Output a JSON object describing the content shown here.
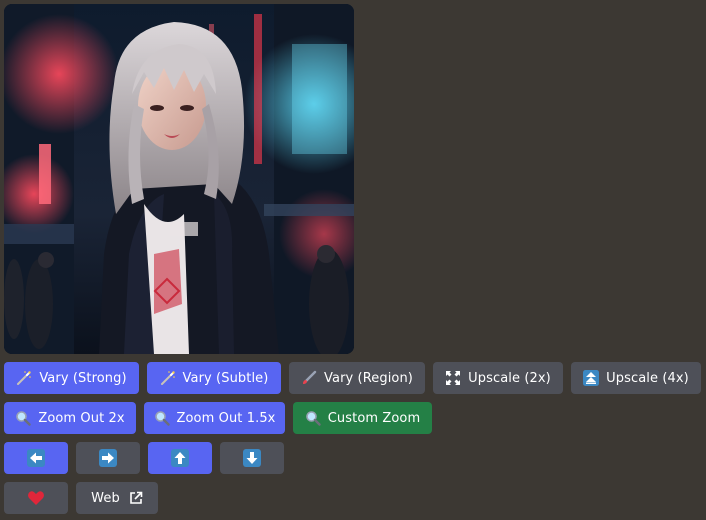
{
  "image": {
    "subject_icon": "cyberpunk-portrait-image",
    "palette": {
      "neon_red": "#ff3b4f",
      "neon_cyan": "#47d6ff",
      "night": "#0c1523",
      "jacket": "#141824",
      "hair": "#c9c4c8"
    }
  },
  "colors": {
    "background": "#3c3833",
    "primary_button": "#5865f2",
    "secondary_button": "#4e5058",
    "success_button": "#248046",
    "heart": "#e0263a"
  },
  "rows": {
    "vary": {
      "strong_label": "Vary (Strong)",
      "strong_icon": "magic-wand-icon",
      "subtle_label": "Vary (Subtle)",
      "subtle_icon": "magic-wand-icon",
      "region_label": "Vary (Region)",
      "region_icon": "paintbrush-icon"
    },
    "upscale": {
      "x2_label": "Upscale (2x)",
      "x2_icon": "expand-icon",
      "x4_label": "Upscale (4x)",
      "x4_icon": "arrow-up-double-icon"
    },
    "zoom": {
      "out2_label": "Zoom Out 2x",
      "out15_label": "Zoom Out 1.5x",
      "custom_label": "Custom Zoom",
      "icon": "magnifier-icon"
    },
    "pan": {
      "left_icon": "arrow-left-icon",
      "right_icon": "arrow-right-icon",
      "up_icon": "arrow-up-icon",
      "down_icon": "arrow-down-icon"
    },
    "actions": {
      "favorite_icon": "heart-icon",
      "web_label": "Web",
      "web_icon": "external-link-icon"
    }
  }
}
